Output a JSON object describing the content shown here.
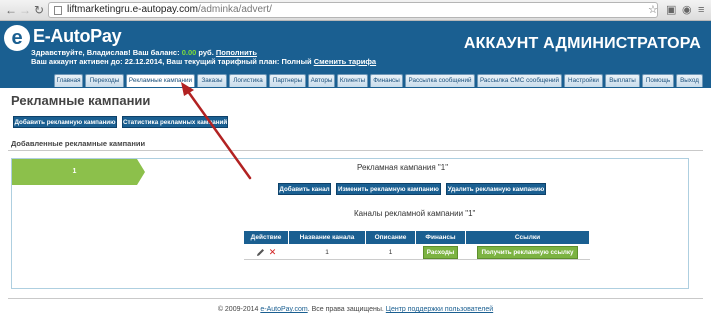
{
  "browser": {
    "url_host": "liftmarketingru.e-autopay.com",
    "url_path": "/adminka/advert/"
  },
  "header": {
    "logo_letter": "e",
    "logo_text": "E-AutoPay",
    "greeting": "Здравствуйте, Владислав!",
    "balance_label": "Ваш баланс:",
    "balance_value": "0.00",
    "balance_currency": "руб.",
    "topup_link": "Пополнить",
    "account_active": "Ваш аккаунт активен до: 22.12.2014, Ваш текущий тарифный план: Полный",
    "change_tariff_link": "Сменить тарифа",
    "admin_title": "АККАУНТ АДМИНИСТРАТОРА"
  },
  "tabs": [
    "Главная",
    "Переходы",
    "Рекламные кампании",
    "Заказы",
    "Логистика",
    "Партнеры",
    "Авторы",
    "Клиенты",
    "Финансы",
    "Рассылка сообщений",
    "Рассылка СМС сообщений",
    "Настройки",
    "Выплаты",
    "Помощь",
    "Выход"
  ],
  "main": {
    "page_title": "Рекламные кампании",
    "add_campaign_button": "Добавить рекламную кампанию",
    "stats_button": "Статистика рекламных кампаний",
    "added_section_label": "Добавленные рекламные кампании",
    "campaign_tab_label": "1",
    "campaign_name": "Рекламная кампания \"1\"",
    "add_channel_button": "Добавить канал",
    "edit_campaign_button": "Изменить рекламную кампанию",
    "delete_campaign_button": "Удалить рекламную кампанию",
    "channels_title": "Каналы рекламной кампании \"1\"",
    "table": {
      "headers": [
        "Действие",
        "Название канала",
        "Описание",
        "Финансы",
        "Ссылки"
      ],
      "rows": [
        {
          "name": "1",
          "description": "1",
          "finance_button": "Расходы",
          "link_button": "Получить рекламную ссылку"
        }
      ]
    }
  },
  "footer": {
    "copyright_prefix": "© 2009-2014",
    "site_link": "e-AutoPay.com",
    "rights": ". Все права защищены.",
    "support_link": "Центр поддержки пользователей"
  },
  "colors": {
    "brand_blue": "#1a5f91",
    "accent_green": "#8cc04b",
    "balance_green": "#7ddc3c",
    "annotation_red": "#b22222"
  }
}
